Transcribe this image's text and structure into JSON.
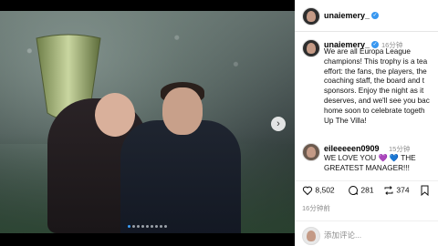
{
  "post": {
    "username": "unaiemery_",
    "photo_dots": 9,
    "active_dot": 0
  },
  "caption": {
    "username": "unaiemery_",
    "time": "16分钟",
    "text": "We are all Europa League\nchampions! This trophy is a tea\neffort: the fans, the players, the\ncoaching staff, the board and t\nsponsors. Enjoy the night as it\ndeserves, and we'll see you bac\nhome soon to celebrate togeth\nUp The Villa!"
  },
  "comment": {
    "username": "eileeeeen0909",
    "time": "15分钟",
    "text": "WE LOVE YOU 💜 💙 THE\nGREATEST MANAGER!!!"
  },
  "actions": {
    "likes": "8,502",
    "comments": "281",
    "shares": "374",
    "time": "16分钟前"
  },
  "add_comment": {
    "placeholder": "添加评论..."
  },
  "colors": {
    "verified": "#3897f0",
    "comment_heart_1": "#a259ff",
    "comment_heart_2": "#3a7bd5"
  }
}
